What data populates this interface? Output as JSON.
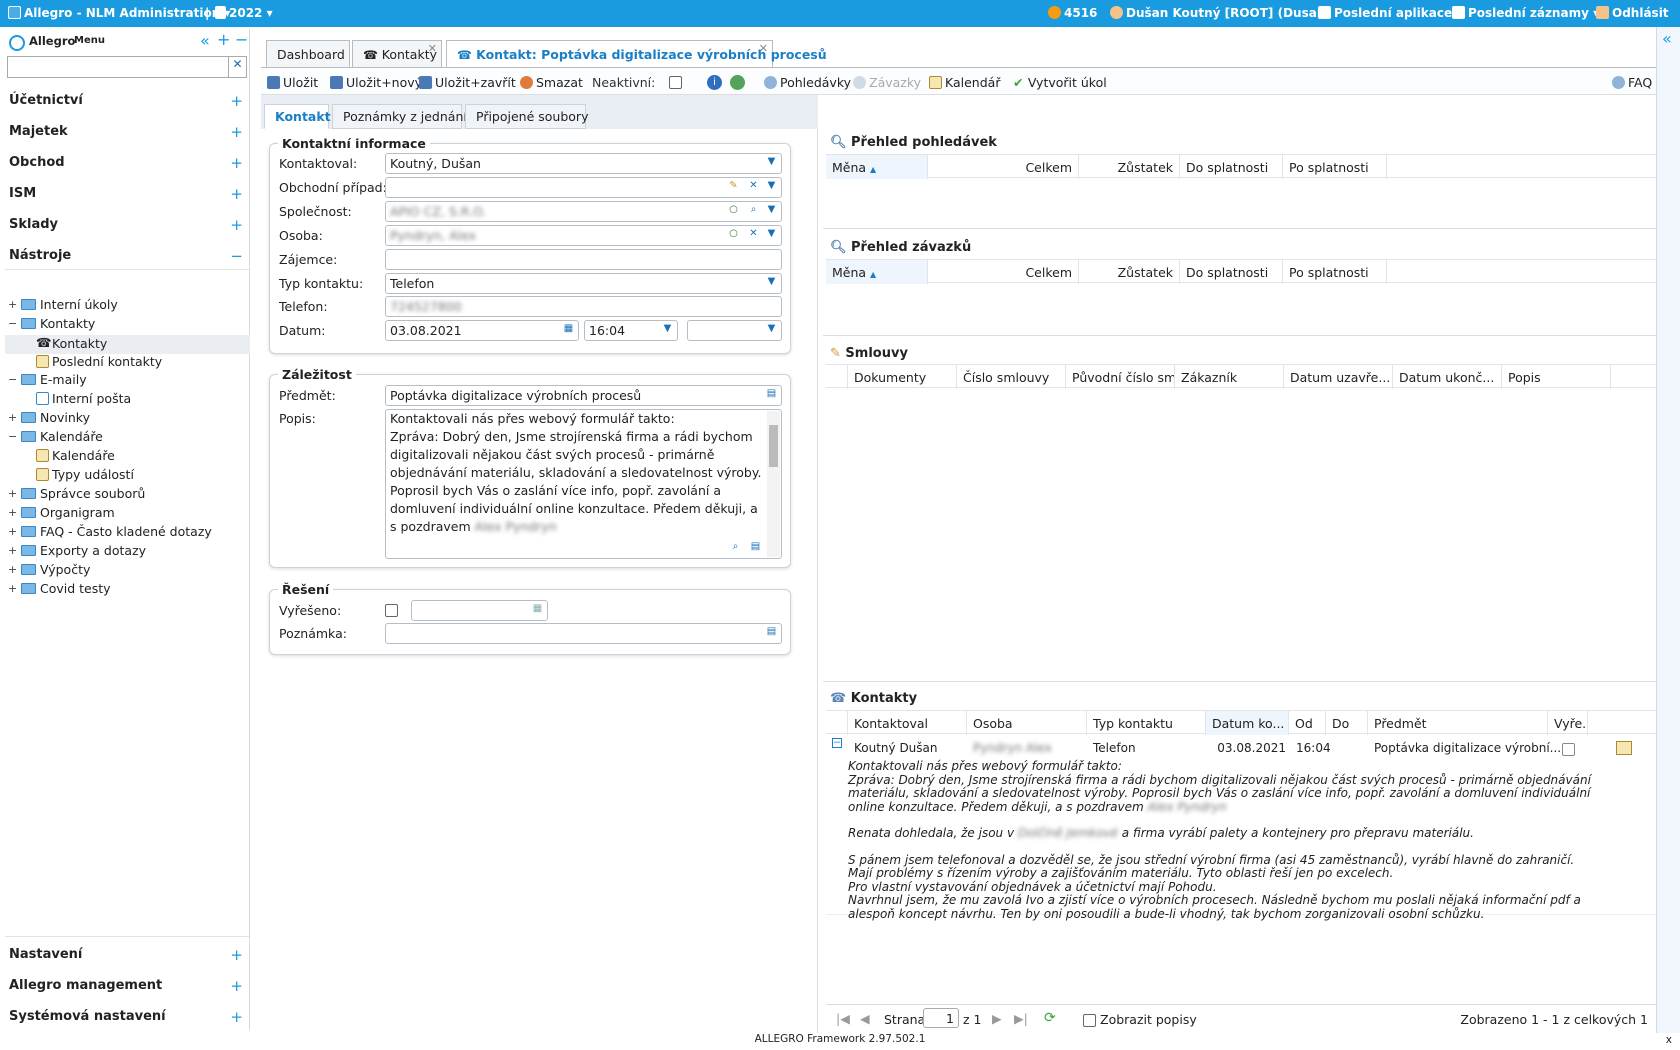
{
  "topbar": {
    "app": "Allegro - NLM Administration",
    "year": "2022",
    "alerts": "4516",
    "user": "Dušan Koutný [ROOT] (Dusan)",
    "recent_apps": "Poslední aplikace",
    "recent_records": "Poslední záznamy",
    "logout": "Odhlásit"
  },
  "sidebar": {
    "logo": "Allegro",
    "menu": "Menu",
    "sections": [
      "Účetnictví",
      "Majetek",
      "Obchod",
      "ISM",
      "Sklady",
      "Nástroje"
    ],
    "bottom": [
      "Nastavení",
      "Allegro management",
      "Systémová nastavení"
    ],
    "tree": [
      "Interní úkoly",
      "Kontakty",
      "Kontakty",
      "Poslední kontakty",
      "E-maily",
      "Interní pošta",
      "Novinky",
      "Kalendáře",
      "Kalendáře",
      "Typy událostí",
      "Správce souborů",
      "Organigram",
      "FAQ - Často kladené dotazy",
      "Exporty a dotazy",
      "Výpočty",
      "Covid testy"
    ]
  },
  "tabs": [
    "Dashboard",
    "Kontakty",
    "Kontakt: Poptávka digitalizace výrobních procesů"
  ],
  "toolbar": {
    "save": "Uložit",
    "save_new": "Uložit+nový",
    "save_close": "Uložit+zavřít",
    "delete": "Smazat",
    "inactive": "Neaktivní:",
    "receivables": "Pohledávky",
    "liabilities": "Závazky",
    "calendar": "Kalendář",
    "create_task": "Vytvořit úkol",
    "faq": "FAQ"
  },
  "subtabs": [
    "Kontakt",
    "Poznámky z jednání",
    "Připojené soubory"
  ],
  "contact_info": {
    "legend": "Kontaktní informace",
    "labels": [
      "Kontaktoval:",
      "Obchodní případ:",
      "Společnost:",
      "Osoba:",
      "Zájemce:",
      "Typ kontaktu:",
      "Telefon:",
      "Datum:"
    ],
    "contacted_by": "Koutný, Dušan",
    "business_case": "",
    "company": "APIO CZ, S.R.O.",
    "person": "Pyndryn, Alex",
    "interested": "",
    "contact_type": "Telefon",
    "phone": "724527800",
    "date": "03.08.2021",
    "time": "16:04",
    "time_to": ""
  },
  "matter": {
    "legend": "Záležitost",
    "subject_label": "Předmět:",
    "desc_label": "Popis:",
    "subject": "Poptávka digitalizace výrobních procesů",
    "description": "Kontaktovali nás přes webový formulář takto:\nZpráva: Dobrý den, Jsme strojírenská firma a rádi bychom digitalizovali nějakou část svých procesů - primárně objednávání materiálu, skladování a sledovatelnost výroby. Poprosil bych Vás o zaslání více info, popř. zavolání a domluvení individuální online konzultace. Předem děkuji, a s pozdravem",
    "desc_name": "Alex Pyndryn"
  },
  "resolution": {
    "legend": "Řešení",
    "resolved_label": "Vyřešeno:",
    "note_label": "Poznámka:"
  },
  "receivables": {
    "title": "Přehled pohledávek",
    "cols": [
      "Měna",
      "Celkem",
      "Zůstatek",
      "Do splatnosti",
      "Po splatnosti"
    ]
  },
  "liabilities": {
    "title": "Přehled závazků",
    "cols": [
      "Měna",
      "Celkem",
      "Zůstatek",
      "Do splatnosti",
      "Po splatnosti"
    ]
  },
  "contracts": {
    "title": "Smlouvy",
    "cols": [
      "Dokumenty",
      "Číslo smlouvy",
      "Původní číslo sm...",
      "Zákazník",
      "Datum uzavře...",
      "Datum ukonč...",
      "Popis"
    ]
  },
  "contacts": {
    "title": "Kontakty",
    "cols": [
      "Kontaktoval",
      "Osoba",
      "Typ kontaktu",
      "Datum ko...",
      "Od",
      "Do",
      "Předmět",
      "Vyře..."
    ],
    "row": {
      "by": "Koutný Dušan",
      "person": "Pyndryn Alex",
      "type": "Telefon",
      "date": "03.08.2021",
      "from": "16:04",
      "to": "",
      "subject": "Poptávka digitalizace výrobní..."
    },
    "desc": [
      "Kontaktovali nás přes webový formulář takto:",
      "Zpráva: Dobrý den, Jsme strojírenská firma a rádi bychom digitalizovali nějakou část svých procesů - primárně objednávání materiálu, skladování a sledovatelnost výroby. Poprosil bych Vás o zaslání více info, popř. zavolání a domluvení individuální online konzultace. Předem děkuji, a s pozdravem",
      "Renata dohledala, že jsou v",
      "a firma vyrábí palety a kontejnery pro přepravu materiálu.",
      "S pánem jsem telefonoval a dozvěděl se, že jsou střední výrobní firma (asi 45 zaměstnanců), vyrábí hlavně do zahraničí.",
      "Mají problémy s řízením výroby a zajišťováním materiálu. Tyto oblasti řeší jen po excelech.",
      "Pro vlastní vystavování objednávek a účetnictví mají Pohodu.",
      "Navrhnul jsem, že mu zavolá Ivo a zjistí více o výrobních procesech. Následně bychom mu poslali nějaká informační pdf a alespoň koncept návrhu. Ten by oni posoudili a bude-li vhodný, tak bychom zorganizovali osobní schůzku."
    ],
    "desc_name": "Alex Pyndryn",
    "desc_place": "Dolčíně Jemkové"
  },
  "pager": {
    "page_label": "Strana",
    "page": "1",
    "of": "z 1",
    "show_desc": "Zobrazit popisy",
    "summary": "Zobrazeno 1 - 1 z celkových 1"
  },
  "footer": "ALLEGRO Framework 2.97.502.1"
}
